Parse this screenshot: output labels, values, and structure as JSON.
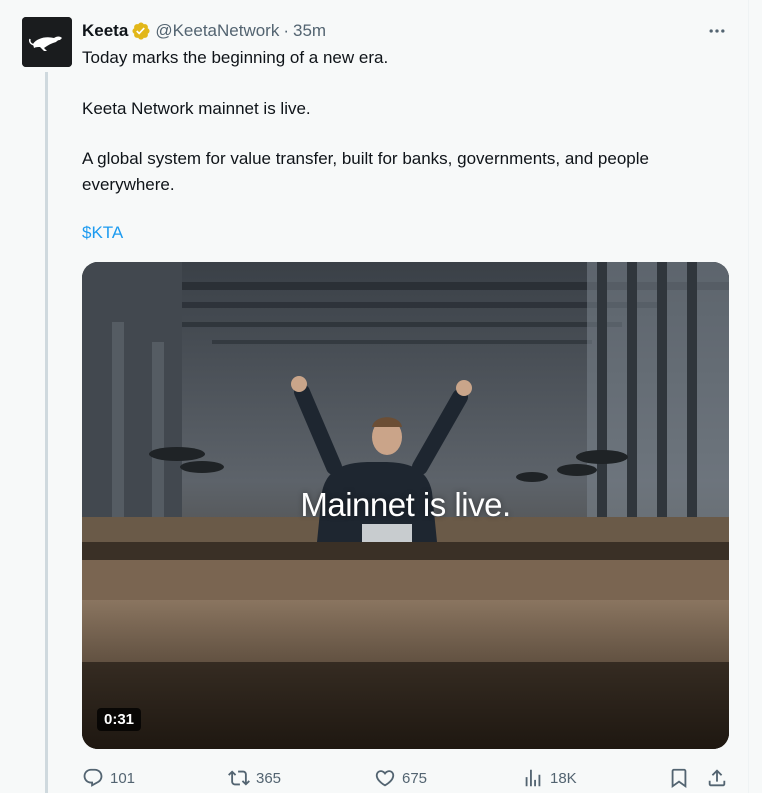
{
  "tweet": {
    "author_name": "Keeta",
    "handle": "@KeetaNetwork",
    "separator": "·",
    "time": "35m",
    "text_lines": [
      "Today marks the beginning of a new era.",
      "Keeta Network mainnet is live.",
      "A global system for value transfer, built for banks, governments, and people everywhere."
    ],
    "cashtag": "$KTA",
    "media": {
      "overlay_text": "Mainnet is live.",
      "duration": "0:31"
    },
    "actions": {
      "replies": "101",
      "reposts": "365",
      "likes": "675",
      "views": "18K"
    }
  },
  "icons": {
    "avatar": "keeta-cheetah-logo",
    "verified": "gold-verified-badge",
    "more": "more-horizontal-icon",
    "reply": "reply-icon",
    "repost": "repost-icon",
    "like": "heart-icon",
    "views": "views-chart-icon",
    "bookmark": "bookmark-icon",
    "share": "share-icon"
  },
  "colors": {
    "link": "#1d9bf0",
    "secondary_text": "#536471",
    "verified_gold": "#e2b719",
    "thread_line": "#cfd9de"
  }
}
